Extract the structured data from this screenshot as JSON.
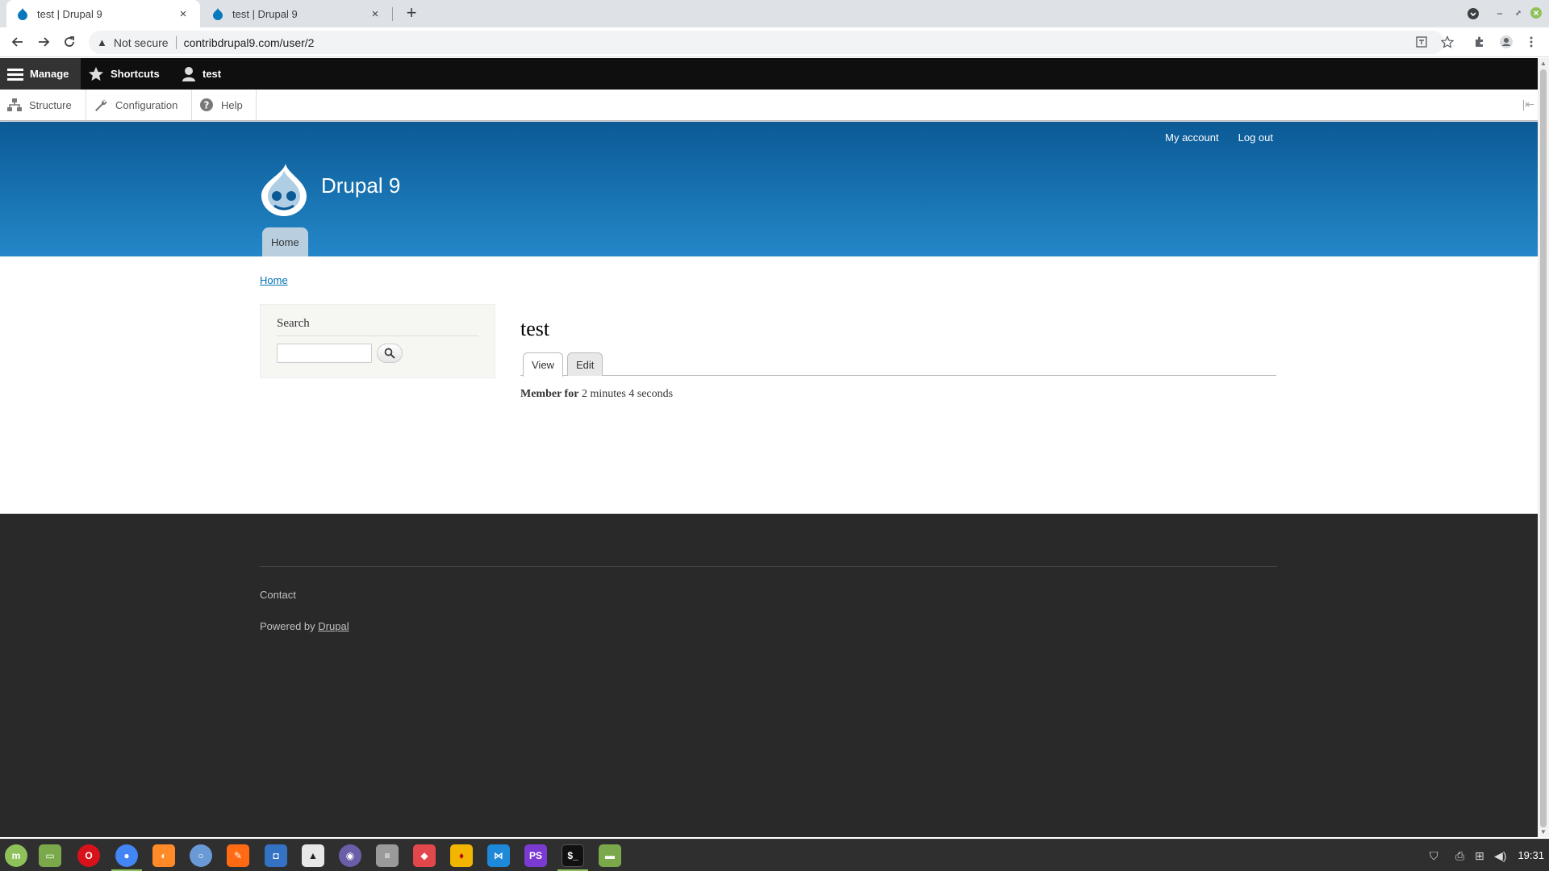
{
  "browser": {
    "tabs": [
      {
        "title": "test | Drupal 9",
        "close": "×"
      },
      {
        "title": "test | Drupal 9",
        "close": "×"
      }
    ],
    "new_tab": "+",
    "security_label": "Not secure",
    "url": "contribdrupal9.com/user/2"
  },
  "admin_toolbar": {
    "manage": "Manage",
    "shortcuts": "Shortcuts",
    "user": "test",
    "tray": [
      "Structure",
      "Configuration",
      "Help"
    ]
  },
  "site": {
    "secondary_menu": [
      "My account",
      "Log out"
    ],
    "name": "Drupal 9",
    "main_menu": [
      "Home"
    ],
    "brand_color": "#0b5a96"
  },
  "content": {
    "breadcrumb": "Home",
    "search_block": {
      "title": "Search",
      "placeholder": ""
    },
    "page_title": "test",
    "local_tabs": [
      "View",
      "Edit"
    ],
    "member_for_label": "Member for",
    "member_for_value": "2 minutes 4 seconds"
  },
  "footer": {
    "contact": "Contact",
    "powered_by": "Powered by",
    "powered_by_link": "Drupal"
  },
  "taskbar": {
    "clock": "19:31",
    "apps": [
      "mint-menu-icon",
      "files-icon",
      "opera-icon",
      "chrome-icon",
      "firefox-icon",
      "chromium-icon",
      "sublime-icon",
      "screenshot-icon",
      "inkscape-icon",
      "obs-icon",
      "database-icon",
      "git-icon",
      "filezilla-icon",
      "vscode-icon",
      "phpstorm-icon",
      "terminal-icon",
      "folder-icon"
    ]
  }
}
